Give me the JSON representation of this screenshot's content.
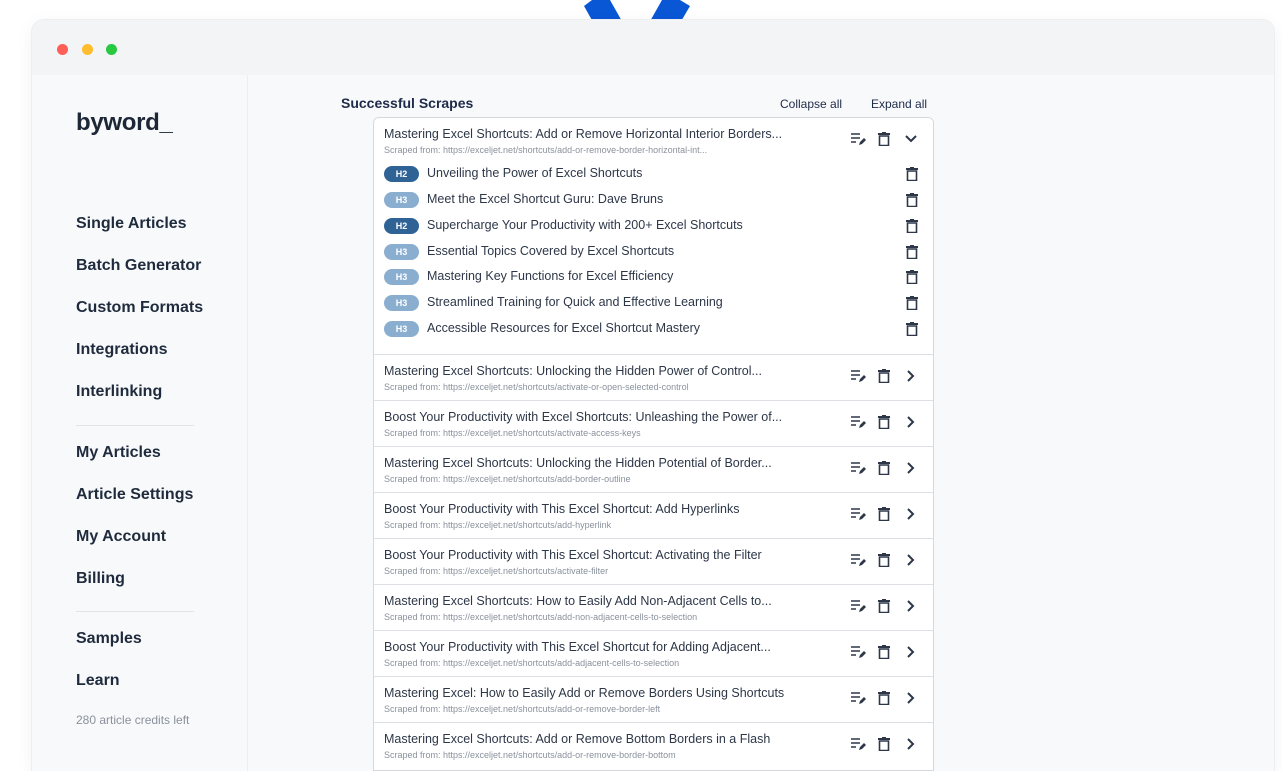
{
  "app": {
    "logo": "byword_"
  },
  "sidebar": {
    "items": [
      {
        "label": "Single Articles"
      },
      {
        "label": "Batch Generator"
      },
      {
        "label": "Custom Formats"
      },
      {
        "label": "Integrations"
      },
      {
        "label": "Interlinking"
      },
      {
        "label": "My Articles"
      },
      {
        "label": "Article Settings"
      },
      {
        "label": "My Account"
      },
      {
        "label": "Billing"
      },
      {
        "label": "Samples"
      },
      {
        "label": "Learn"
      }
    ],
    "credits": "280 article credits left"
  },
  "main": {
    "section_title": "Successful Scrapes",
    "collapse_all": "Collapse all",
    "expand_all": "Expand all",
    "expanded": {
      "title": "Mastering Excel Shortcuts: Add or Remove Horizontal Interior Borders...",
      "url": "Scraped from: https://exceljet.net/shortcuts/add-or-remove-border-horizontal-int...",
      "headings": [
        {
          "level": "H2",
          "text": "Unveiling the Power of Excel Shortcuts"
        },
        {
          "level": "H3",
          "text": "Meet the Excel Shortcut Guru: Dave Bruns"
        },
        {
          "level": "H2",
          "text": "Supercharge Your Productivity with 200+ Excel Shortcuts"
        },
        {
          "level": "H3",
          "text": "Essential Topics Covered by Excel Shortcuts"
        },
        {
          "level": "H3",
          "text": "Mastering Key Functions for Excel Efficiency"
        },
        {
          "level": "H3",
          "text": "Streamlined Training for Quick and Effective Learning"
        },
        {
          "level": "H3",
          "text": "Accessible Resources for Excel Shortcut Mastery"
        }
      ]
    },
    "rows": [
      {
        "title": "Mastering Excel Shortcuts: Unlocking the Hidden Power of Control...",
        "url": "Scraped from: https://exceljet.net/shortcuts/activate-or-open-selected-control"
      },
      {
        "title": "Boost Your Productivity with Excel Shortcuts: Unleashing the Power of...",
        "url": "Scraped from: https://exceljet.net/shortcuts/activate-access-keys"
      },
      {
        "title": "Mastering Excel Shortcuts: Unlocking the Hidden Potential of Border...",
        "url": "Scraped from: https://exceljet.net/shortcuts/add-border-outline"
      },
      {
        "title": "Boost Your Productivity with This Excel Shortcut: Add Hyperlinks",
        "url": "Scraped from: https://exceljet.net/shortcuts/add-hyperlink"
      },
      {
        "title": "Boost Your Productivity with This Excel Shortcut: Activating the Filter",
        "url": "Scraped from: https://exceljet.net/shortcuts/activate-filter"
      },
      {
        "title": "Mastering Excel Shortcuts: How to Easily Add Non-Adjacent Cells to...",
        "url": "Scraped from: https://exceljet.net/shortcuts/add-non-adjacent-cells-to-selection"
      },
      {
        "title": "Boost Your Productivity with This Excel Shortcut for Adding Adjacent...",
        "url": "Scraped from: https://exceljet.net/shortcuts/add-adjacent-cells-to-selection"
      },
      {
        "title": "Mastering Excel: How to Easily Add or Remove Borders Using Shortcuts",
        "url": "Scraped from: https://exceljet.net/shortcuts/add-or-remove-border-left"
      },
      {
        "title": "Mastering Excel Shortcuts: Add or Remove Bottom Borders in a Flash",
        "url": "Scraped from: https://exceljet.net/shortcuts/add-or-remove-border-bottom"
      }
    ]
  },
  "icons": {
    "edit": "edit-list-icon",
    "trash": "trash-icon",
    "chevron_down": "chevron-down-icon",
    "chevron_right": "chevron-right-icon",
    "pointer": "pointer-arrow-icon"
  },
  "colors": {
    "badge_h2": "#2f6396",
    "badge_h3": "#8aaed0",
    "arrow": "#0a57d6"
  }
}
